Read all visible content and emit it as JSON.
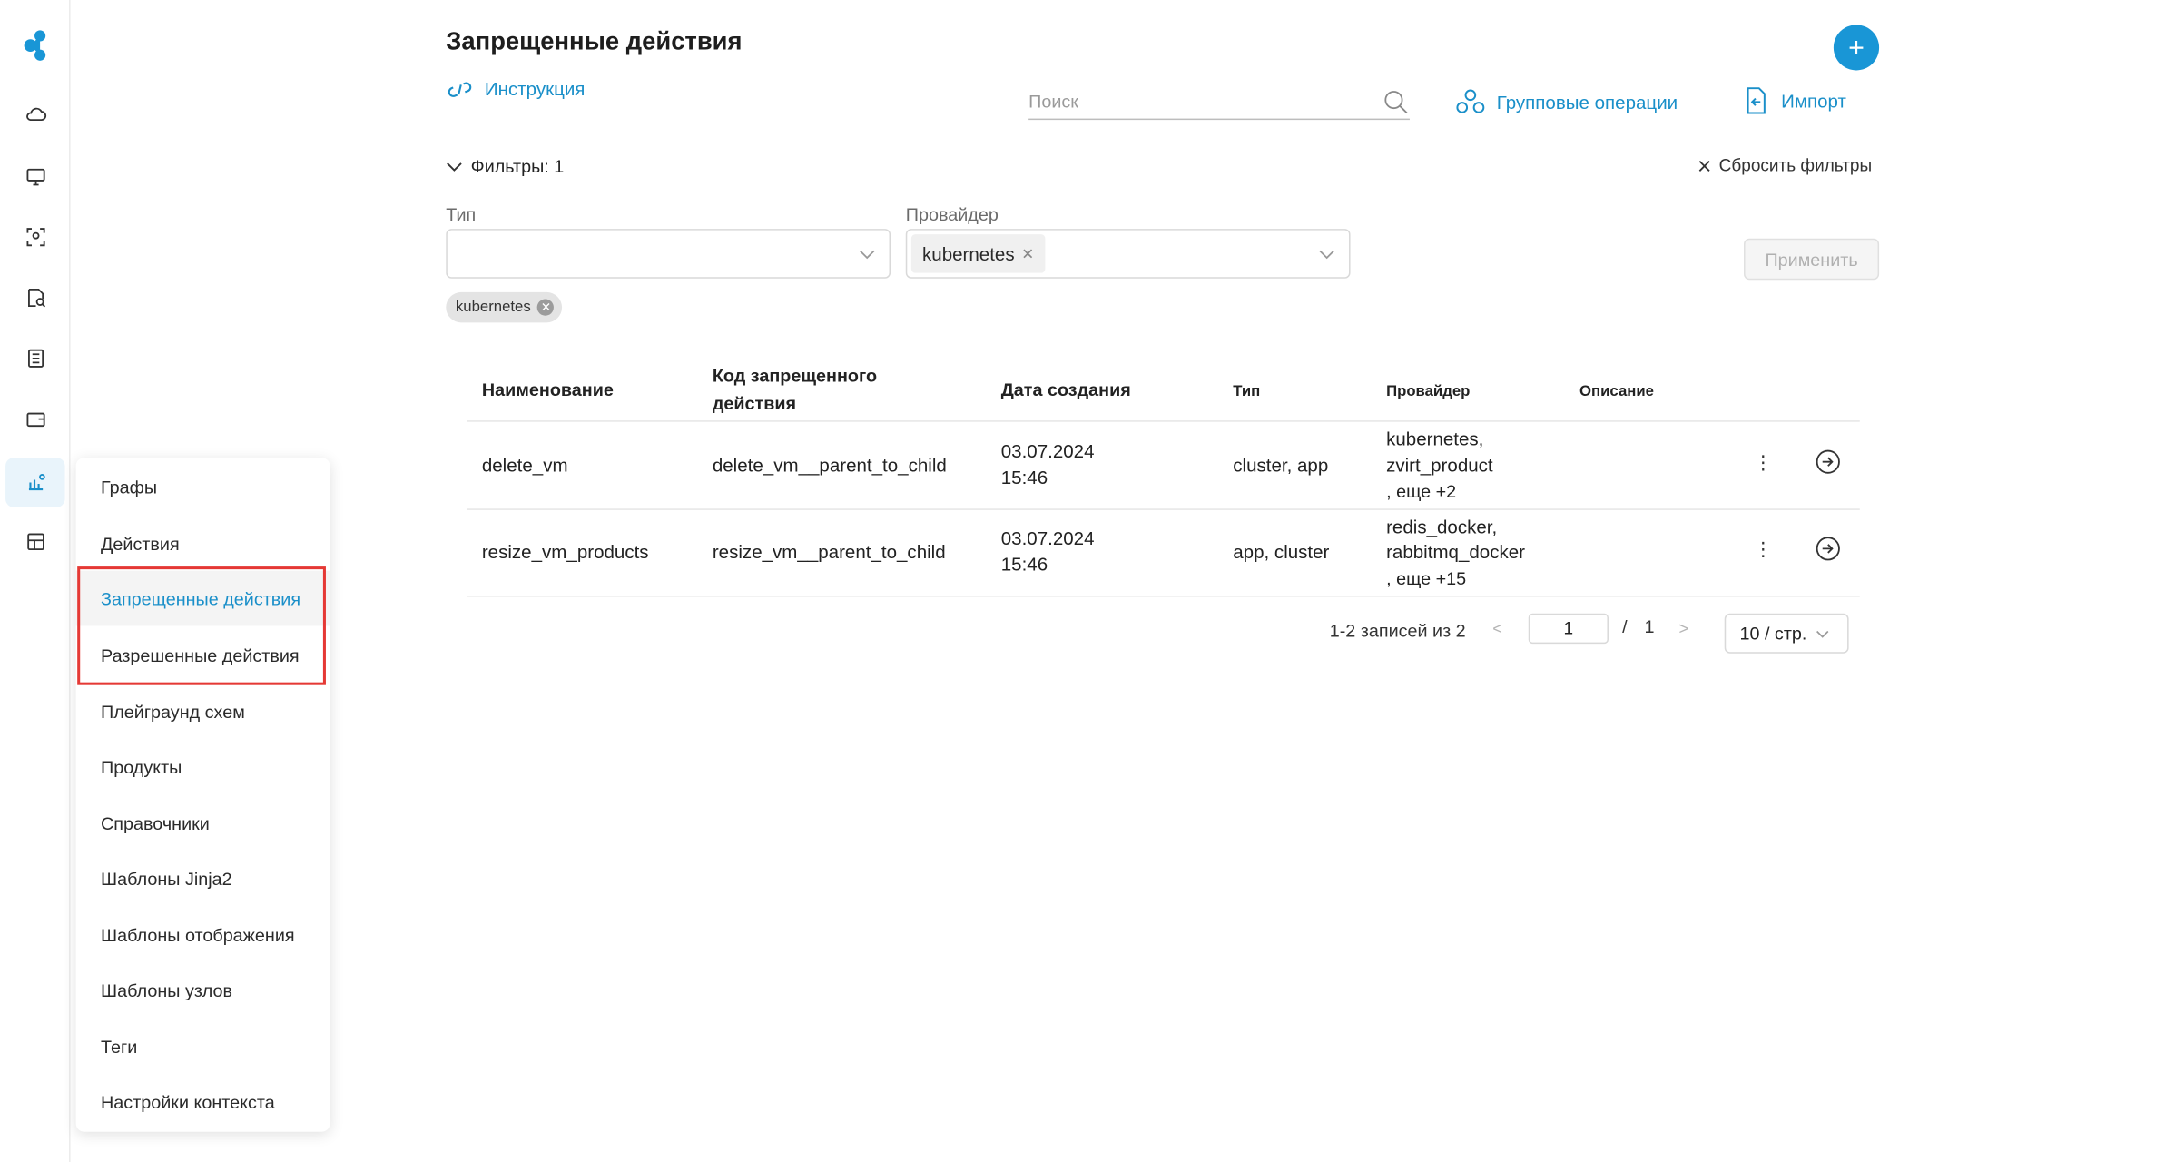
{
  "page": {
    "title": "Запрещенные действия",
    "instruction_link": "Инструкция",
    "add_button": "+"
  },
  "toolbar": {
    "search_placeholder": "Поиск",
    "group_ops": "Групповые операции",
    "import": "Импорт"
  },
  "filters": {
    "toggle_label": "Фильтры: 1",
    "reset_label": "Сбросить фильтры",
    "type_label": "Тип",
    "type_value": "",
    "provider_label": "Провайдер",
    "provider_tag": "kubernetes",
    "apply_label": "Применить",
    "active_chip": "kubernetes"
  },
  "table": {
    "columns": [
      "Наименование",
      "Код запрещенного действия",
      "Дата создания",
      "Тип",
      "Провайдер",
      "Описание"
    ],
    "col_code_line1": "Код запрещенного",
    "col_code_line2": "действия",
    "rows": [
      {
        "name": "delete_vm",
        "code": "delete_vm__parent_to_child",
        "date": "03.07.2024",
        "time": "15:46",
        "type": "cluster, app",
        "provider_line1": "kubernetes,",
        "provider_line2": "zvirt_product",
        "provider_more": ", еще +2",
        "description": ""
      },
      {
        "name": "resize_vm_products",
        "code": "resize_vm__parent_to_child",
        "date": "03.07.2024",
        "time": "15:46",
        "type": "app, cluster",
        "provider_line1": "redis_docker,",
        "provider_line2": "rabbitmq_docker",
        "provider_more": ", еще +15",
        "description": ""
      }
    ]
  },
  "pagination": {
    "summary": "1-2 записей из 2",
    "current_page": "1",
    "separator": "/",
    "total_pages": "1",
    "page_size": "10 / стр."
  },
  "menu": {
    "items": [
      {
        "label": "Графы"
      },
      {
        "label": "Действия"
      },
      {
        "label": "Запрещенные действия",
        "active": true
      },
      {
        "label": "Разрешенные действия"
      },
      {
        "label": "Плейграунд схем"
      },
      {
        "label": "Продукты"
      },
      {
        "label": "Справочники"
      },
      {
        "label": "Шаблоны Jinja2"
      },
      {
        "label": "Шаблоны отображения"
      },
      {
        "label": "Шаблоны узлов"
      },
      {
        "label": "Теги"
      },
      {
        "label": "Настройки контекста"
      }
    ]
  },
  "rail": {
    "icons": [
      "cloud-icon",
      "monitor-settings-icon",
      "user-scan-icon",
      "document-search-icon",
      "list-icon",
      "wallet-icon",
      "graph-icon",
      "dashboard-icon"
    ]
  },
  "colors": {
    "accent": "#1a8fc9",
    "primary_button": "#1996d6",
    "highlight": "#e53935"
  }
}
